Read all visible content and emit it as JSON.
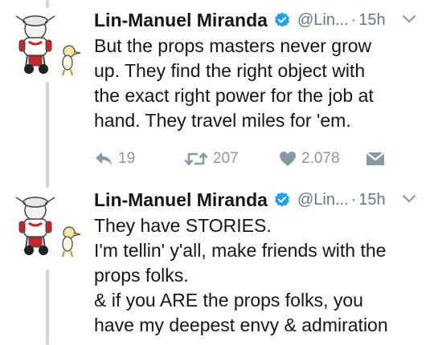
{
  "tweets": [
    {
      "author_name": "Lin-Manuel Miranda",
      "handle": "@Lin...",
      "separator": "·",
      "time": "15h",
      "lines": [
        "But the props masters never grow",
        "up. They find the right object with",
        "the exact right power for the job at",
        "hand. They travel miles for 'em."
      ],
      "replies": "19",
      "retweets": "207",
      "likes": "2.078"
    },
    {
      "author_name": "Lin-Manuel Miranda",
      "handle": "@Lin...",
      "separator": "·",
      "time": "15h",
      "lines": [
        "They have STORIES.",
        "I'm tellin' y'all, make friends with the",
        "props folks.",
        "& if you ARE the props folks, you",
        "have my deepest envy & admiration"
      ]
    }
  ],
  "colors": {
    "text": "#14171a",
    "secondary": "#657786",
    "action": "#8899a6",
    "verified": "#1da1f2",
    "thread_line": "#ccd6dd"
  },
  "icons": [
    "reply-icon",
    "retweet-icon",
    "heart-icon",
    "envelope-icon",
    "verified-badge-icon",
    "chevron-down-icon"
  ]
}
